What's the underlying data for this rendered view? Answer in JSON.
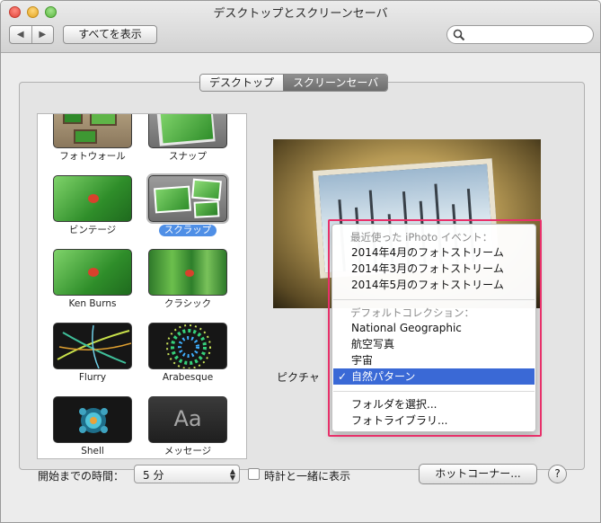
{
  "window": {
    "title": "デスクトップとスクリーンセーバ"
  },
  "toolbar": {
    "back_glyph": "◀",
    "forward_glyph": "▶",
    "show_all_label": "すべてを表示",
    "search_placeholder": ""
  },
  "tabs": [
    {
      "label": "デスクトップ",
      "active": false
    },
    {
      "label": "スクリーンセーバ",
      "active": true
    }
  ],
  "savers": [
    {
      "label": "フォトウォール",
      "icon": "photo-wall-thumbnail"
    },
    {
      "label": "スナップ",
      "icon": "snap-thumbnail"
    },
    {
      "label": "ビンテージ",
      "icon": "vintage-thumbnail"
    },
    {
      "label": "スクラップ",
      "icon": "scrap-thumbnail",
      "selected": true
    },
    {
      "label": "Ken Burns",
      "icon": "ken-burns-thumbnail"
    },
    {
      "label": "クラシック",
      "icon": "classic-thumbnail"
    },
    {
      "label": "Flurry",
      "icon": "flurry-thumbnail"
    },
    {
      "label": "Arabesque",
      "icon": "arabesque-thumbnail"
    },
    {
      "label": "Shell",
      "icon": "shell-thumbnail"
    },
    {
      "label": "メッセージ",
      "icon": "message-thumbnail",
      "thumb_text": "Aa"
    }
  ],
  "picture_label": "ピクチャ",
  "source_menu": {
    "recent_header": "最近使った iPhoto イベント：",
    "recent_items": [
      "2014年4月のフォトストリーム",
      "2014年3月のフォトストリーム",
      "2014年5月のフォトストリーム"
    ],
    "default_header": "デフォルトコレクション：",
    "default_items": [
      "National Geographic",
      "航空写真",
      "宇宙",
      "自然パターン"
    ],
    "selected_item": "自然パターン",
    "check_glyph": "✓",
    "choose_folder": "フォルダを選択...",
    "photo_library": "フォトライブラリ..."
  },
  "footer": {
    "start_after_label": "開始までの時間：",
    "start_after_value": "5 分",
    "show_clock_label": "時計と一緒に表示",
    "show_clock_checked": false,
    "hot_corners_label": "ホットコーナー...",
    "help_label": "?"
  },
  "colors": {
    "accent": "#3a69d6",
    "highlight_border": "#e8306a",
    "selected_label": "#4f8fe6"
  }
}
